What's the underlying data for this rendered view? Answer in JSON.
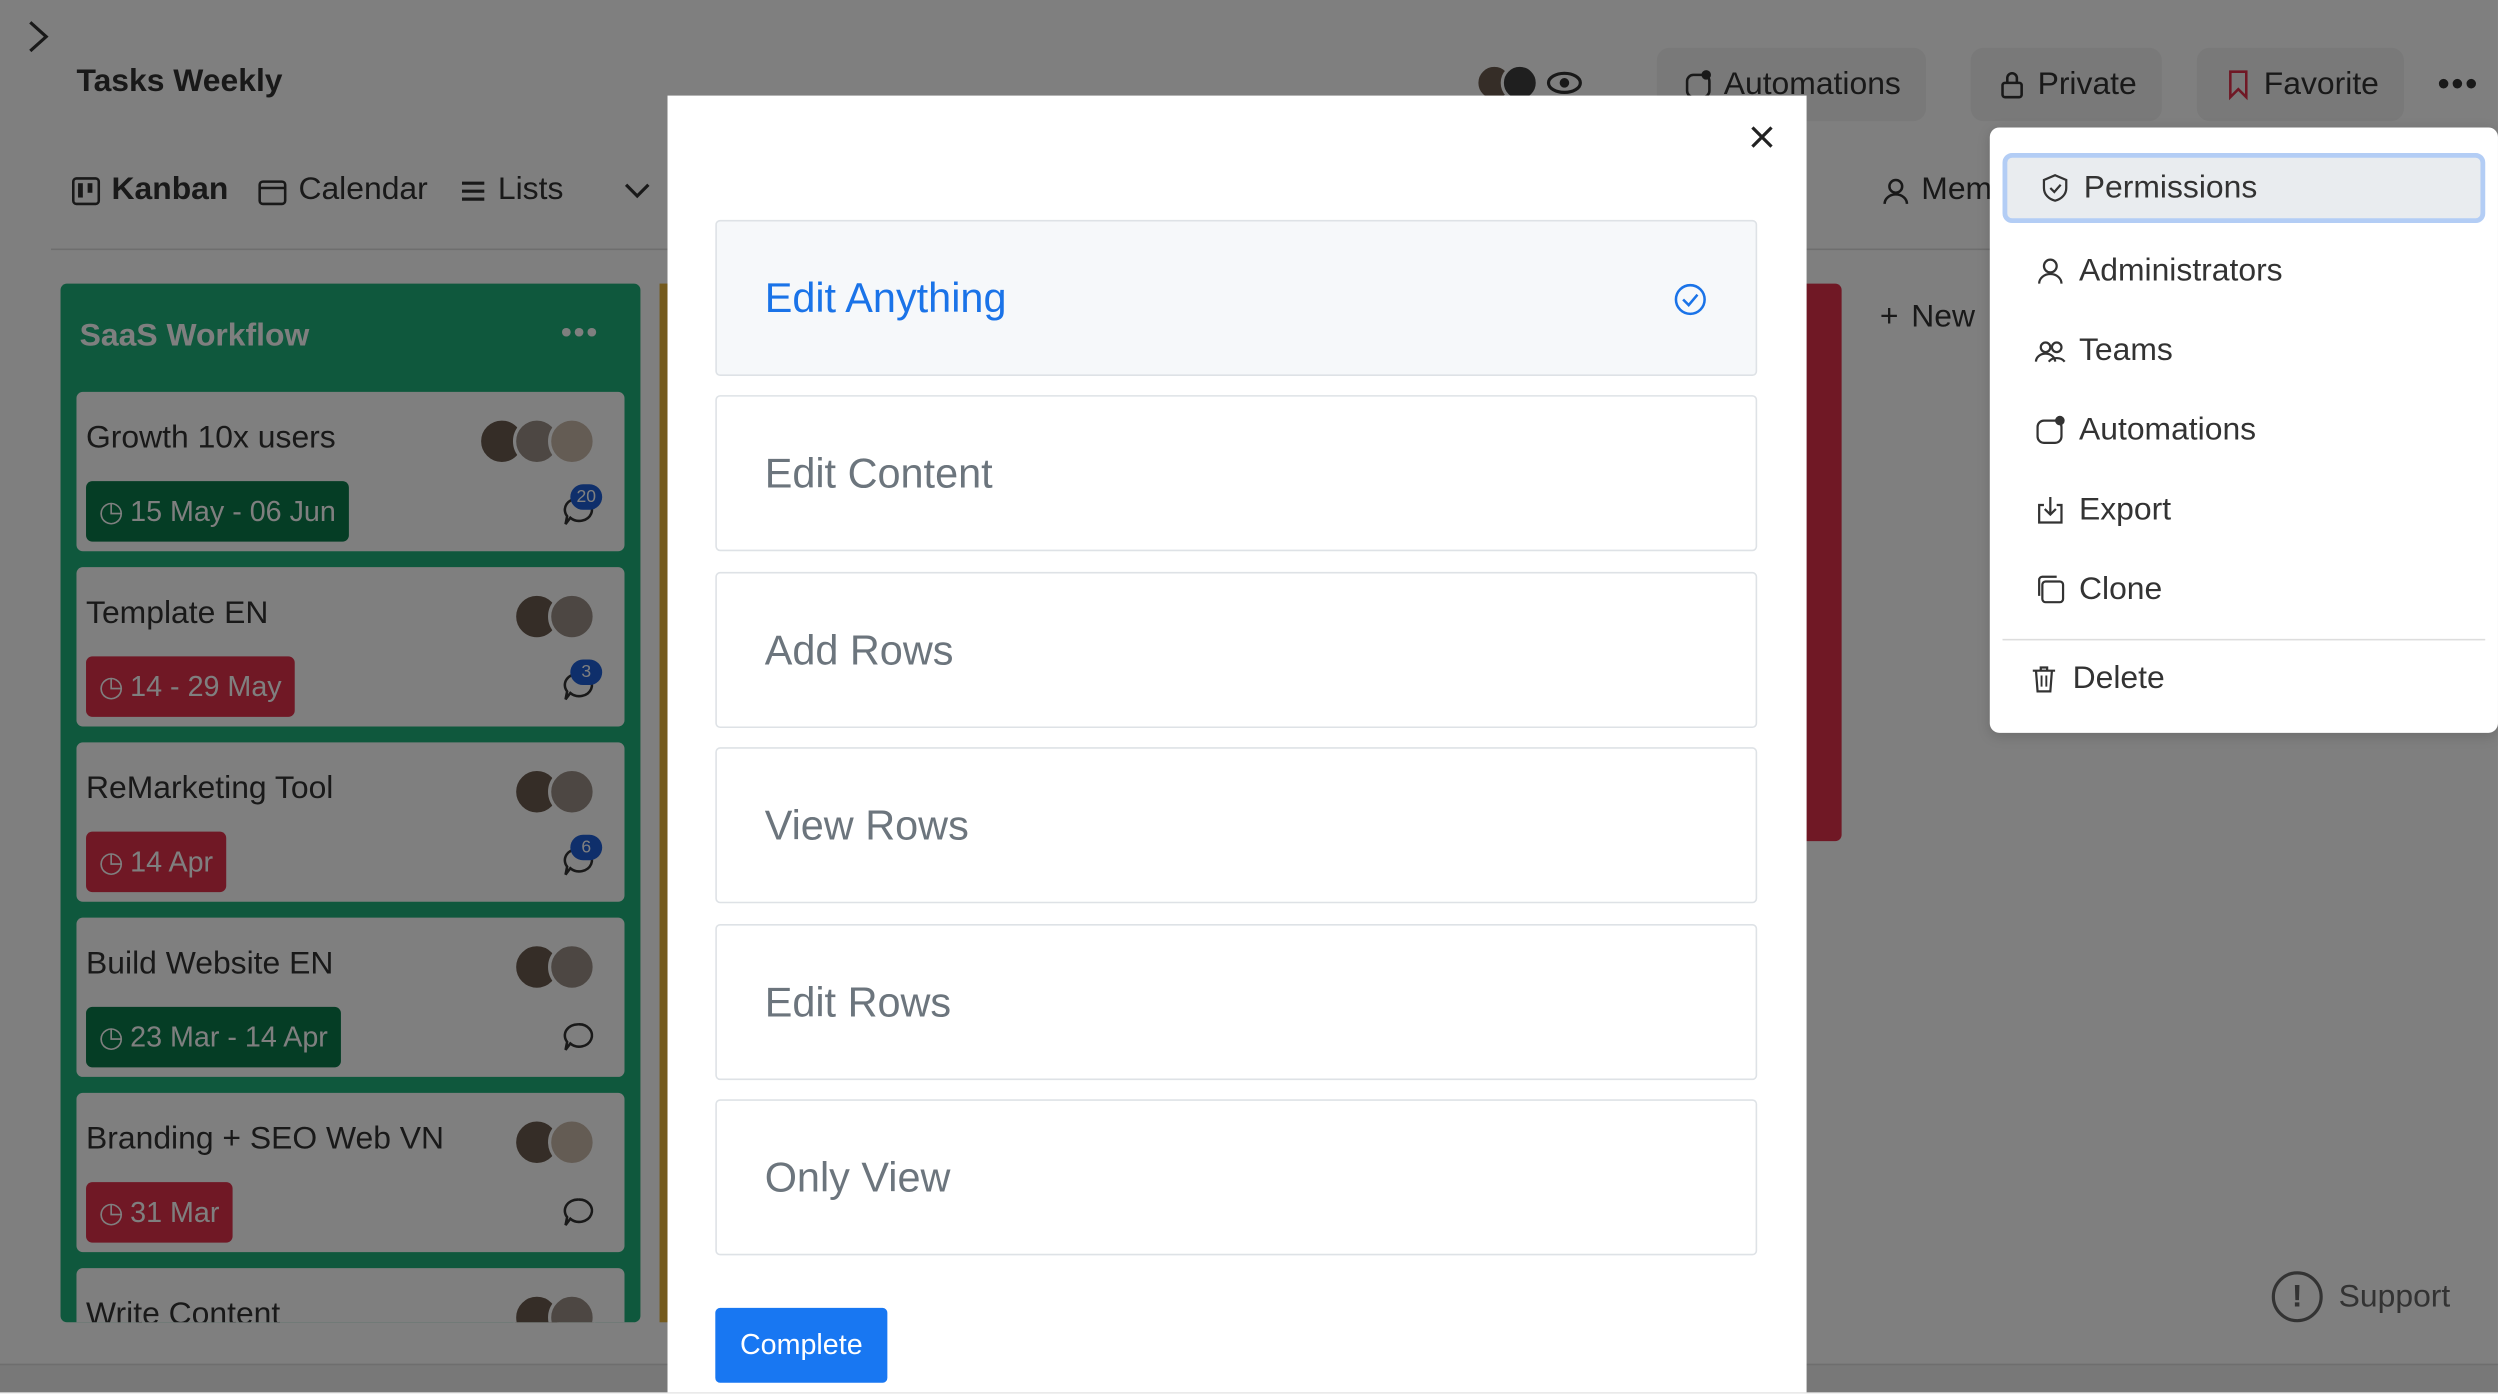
{
  "board": {
    "title": "Tasks Weekly",
    "header_buttons": {
      "automations": "Automations",
      "private": "Private",
      "favorite": "Favorite"
    },
    "views": {
      "kanban": "Kanban",
      "calendar": "Calendar",
      "lists": "Lists"
    },
    "members_label": "Mem",
    "new_column_label": "New",
    "support_label": "Support",
    "column": {
      "title": "SaaS Workflow",
      "cards": [
        {
          "title": "Growth 10x users",
          "date": "15 May - 06 Jun",
          "date_color": "green",
          "comments": "20"
        },
        {
          "title": "Template EN",
          "date": "14 - 29 May",
          "date_color": "red",
          "comments": "3"
        },
        {
          "title": "ReMarketing Tool",
          "date": "14 Apr",
          "date_color": "red",
          "comments": "6"
        },
        {
          "title": "Build Website EN",
          "date": "23 Mar - 14 Apr",
          "date_color": "green",
          "comments": ""
        },
        {
          "title": "Branding + SEO Web VN",
          "date": "31 Mar",
          "date_color": "red",
          "comments": ""
        },
        {
          "title": "Write Content",
          "date": "",
          "date_color": "",
          "comments": ""
        }
      ]
    }
  },
  "modal": {
    "options": [
      {
        "label": "Edit Anything",
        "selected": true
      },
      {
        "label": "Edit Content",
        "selected": false
      },
      {
        "label": "Add Rows",
        "selected": false
      },
      {
        "label": "View Rows",
        "selected": false
      },
      {
        "label": "Edit Rows",
        "selected": false
      },
      {
        "label": "Only View",
        "selected": false
      }
    ],
    "complete_label": "Complete"
  },
  "menu": {
    "items": [
      {
        "label": "Permissions",
        "icon": "shield-icon"
      },
      {
        "label": "Administrators",
        "icon": "user-icon"
      },
      {
        "label": "Teams",
        "icon": "users-icon"
      },
      {
        "label": "Automations",
        "icon": "automation-icon"
      },
      {
        "label": "Export",
        "icon": "export-icon"
      },
      {
        "label": "Clone",
        "icon": "clone-icon"
      },
      {
        "label": "Delete",
        "icon": "trash-icon"
      }
    ]
  },
  "colors": {
    "accent": "#1877f2",
    "column_green": "#1fb17a",
    "date_green": "#0b7a4a",
    "date_red": "#e0314b"
  }
}
